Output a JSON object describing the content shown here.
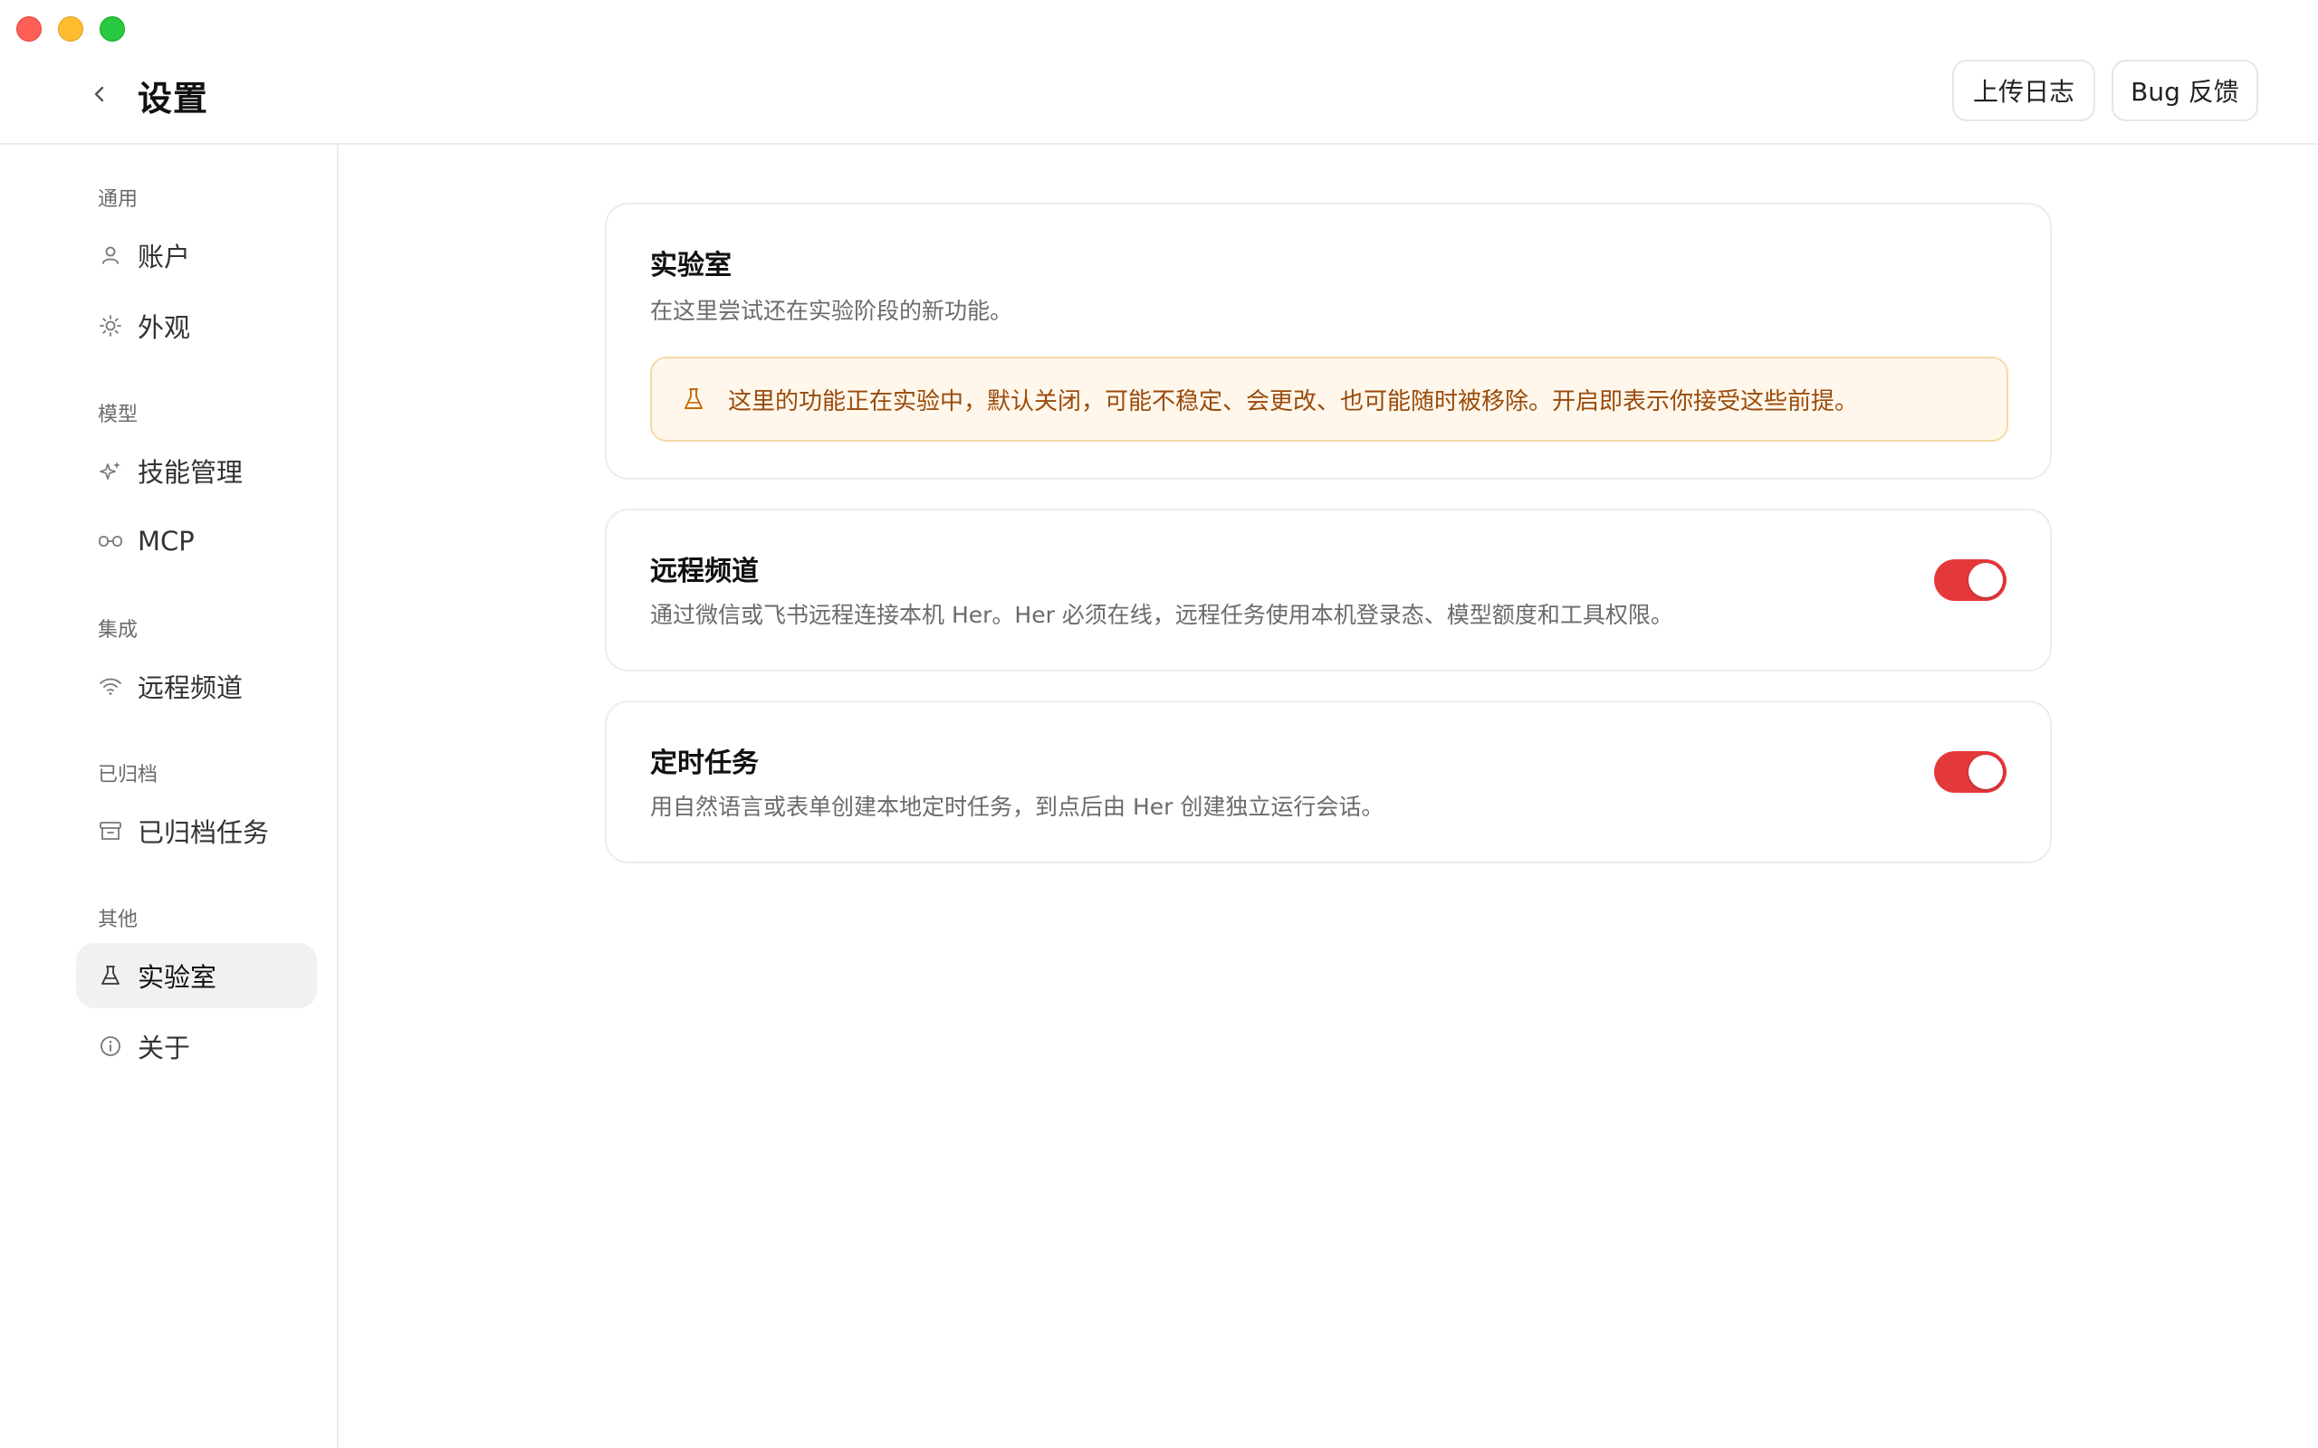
{
  "header": {
    "title": "设置",
    "upload_logs": "上传日志",
    "bug_feedback": "Bug 反馈"
  },
  "sidebar": {
    "sections": [
      {
        "label": "通用"
      },
      {
        "label": "模型"
      },
      {
        "label": "集成"
      },
      {
        "label": "已归档"
      },
      {
        "label": "其他"
      }
    ],
    "items": [
      {
        "label": "账户",
        "icon": "user-icon"
      },
      {
        "label": "外观",
        "icon": "sun-icon"
      },
      {
        "label": "技能管理",
        "icon": "sparkle-icon"
      },
      {
        "label": "MCP",
        "icon": "plug-icon"
      },
      {
        "label": "远程频道",
        "icon": "wifi-icon"
      },
      {
        "label": "已归档任务",
        "icon": "archive-icon"
      },
      {
        "label": "实验室",
        "icon": "flask-icon",
        "active": true
      },
      {
        "label": "关于",
        "icon": "info-icon"
      }
    ]
  },
  "lab_card": {
    "title": "实验室",
    "description": "在这里尝试还在实验阶段的新功能。",
    "warning": "这里的功能正在实验中，默认关闭，可能不稳定、会更改、也可能随时被移除。开启即表示你接受这些前提。"
  },
  "remote_card": {
    "title": "远程频道",
    "description": "通过微信或飞书远程连接本机 Her。Her 必须在线，远程任务使用本机登录态、模型额度和工具权限。",
    "enabled": true
  },
  "schedule_card": {
    "title": "定时任务",
    "description": "用自然语言或表单创建本地定时任务，到点后由 Her 创建独立运行会话。",
    "enabled": true
  },
  "colors": {
    "accent": "#e5383b",
    "warning_bg": "#fff7eb",
    "warning_text": "#9a4a0b"
  }
}
